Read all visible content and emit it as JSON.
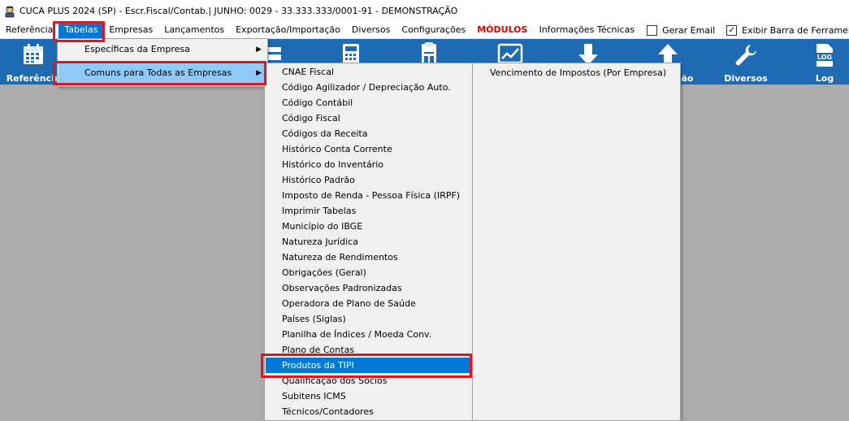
{
  "window": {
    "title": "CUCA PLUS 2024 (SP) - Escr.Fiscal/Contab.| JUNHO: 0029 - 33.333.333/0001-91 - DEMONSTRAÇÃO",
    "icon": "app-logo-icon"
  },
  "menubar": {
    "items": [
      {
        "label": "Referência"
      },
      {
        "label": "Tabelas"
      },
      {
        "label": "Empresas"
      },
      {
        "label": "Lançamentos"
      },
      {
        "label": "Exportação/Importação"
      },
      {
        "label": "Diversos"
      },
      {
        "label": "Configurações"
      },
      {
        "label": "MÓDULOS"
      },
      {
        "label": "Informações Técnicas"
      }
    ],
    "checkboxes": [
      {
        "label": "Gerar Email",
        "checked": false
      },
      {
        "label": "Exibir Barra de Ferramentas",
        "checked": true
      }
    ],
    "check_mark": "✓"
  },
  "toolbar": {
    "referencia_label": "Referência",
    "partial_label": "ão",
    "diversos_label": "Diversos",
    "log_label": "Log",
    "log_icon_text": "LOG",
    "color": "#1e6ab3"
  },
  "tabelas_menu": {
    "items": [
      {
        "label": "Específicas da Empresa",
        "arrow": "▶"
      },
      {
        "label": "Comuns para Todas as Empresas",
        "arrow": "▶"
      }
    ]
  },
  "comuns_menu": {
    "items": [
      "CNAE Fiscal",
      "Código Agilizador / Depreciação Auto.",
      "Código Contábil",
      "Código Fiscal",
      "Códigos da Receita",
      "Histórico Conta Corrente",
      "Histórico do Inventário",
      "Histórico Padrão",
      "Imposto de Renda - Pessoa Física (IRPF)",
      "Imprimir Tabelas",
      "Município do IBGE",
      "Natureza Jurídica",
      "Natureza de Rendimentos",
      "Obrigações (Geral)",
      "Observações Padronizadas",
      "Operadora de Plano de Saúde",
      "Países (Siglas)",
      "Planilha de Índices / Moeda Conv.",
      "Plano de Contas",
      "Produtos da TIPI",
      "Qualificação dos Sócios",
      "Subitens ICMS",
      "Técnicos/Contadores"
    ],
    "selected_index": 19
  },
  "cnae_submenu": {
    "items": [
      "Vencimento de Impostos (Por Empresa)"
    ]
  },
  "colors": {
    "highlight_red": "#e3141c",
    "selection_blue": "#0078d7",
    "hover_light_blue": "#91c9f7",
    "modulos_red": "#e00000"
  }
}
